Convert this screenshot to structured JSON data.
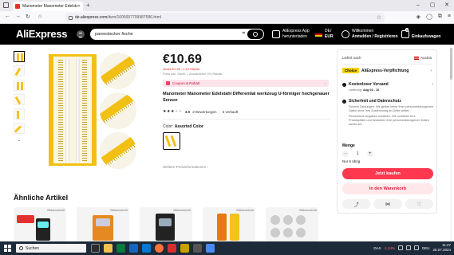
{
  "browser": {
    "tab_title": "Manometer Manometer Edelstahl D",
    "url_host": "de.aliexpress.com",
    "url_path": "/item/1005007799987586.html"
  },
  "header": {
    "logo": "AliExpress",
    "search_value": "pareestecker fische",
    "app_line1": "AliExpress App",
    "app_line2": "herunterladen",
    "lang_line1": "DE/",
    "lang_line2": "EUR",
    "account_line1": "Willkommen",
    "account_line2": "Anmelden / Registrieren",
    "cart_count": "0",
    "cart_label": "Einkaufswagen"
  },
  "product": {
    "price": "€10.69",
    "price_sub": "Jedes €1.99 - x 10 Stücke",
    "tax_note": "Preis inkl. MwSt. | Zusätzlicher 5% Rabatt",
    "coupon_label": "Coupon & Rabatt",
    "title": "Manometer Manometer Edelstahl Differential werkzeug U-förmiger hochgenauer Sensor",
    "rating_value": "3.0",
    "reviews": "2 Bewertungen",
    "sold": "5 verkauft",
    "rating_stars": 3,
    "color_label": "Color:",
    "color_value": "Assorted Color",
    "more_info": "Weitere Preisinformationen"
  },
  "similar": {
    "title": "Ähnliche Artikel",
    "card_tag": "Bildausschnitt"
  },
  "panel": {
    "ship_to": "Liefert nach",
    "country": "Austria",
    "choice_badge": "Choice",
    "choice_text": "AliExpress-Verpflichtung",
    "return_title": "Kostenloser Versand",
    "delivery_label": "Lieferung:",
    "delivery_date": "Aug 03 - 10",
    "security_title": "Sicherheit und Datenschutz",
    "security_body1": "Sichere Zahlungen: Wir geben keine Ihrer personenbezogenen Daten ohne Ihre Zustimmung an Dritte weiter.",
    "security_body2": "Persönliche Angaben schützen: Wir schützen Ihre Privatsphäre und bewahren Ihre personenbezogenen Daten sicher auf.",
    "qty_label": "Menge",
    "qty_value": "1",
    "stock": "Nur 6 übrig",
    "buy_now": "Jetzt kaufen",
    "add_cart": "In den Warenkorb"
  },
  "taskbar": {
    "search": "Suchen",
    "ticker_name": "DAX",
    "ticker_change": "-1,04%",
    "time": "11:27",
    "date": "25.07.2024",
    "lang": "DEU"
  }
}
